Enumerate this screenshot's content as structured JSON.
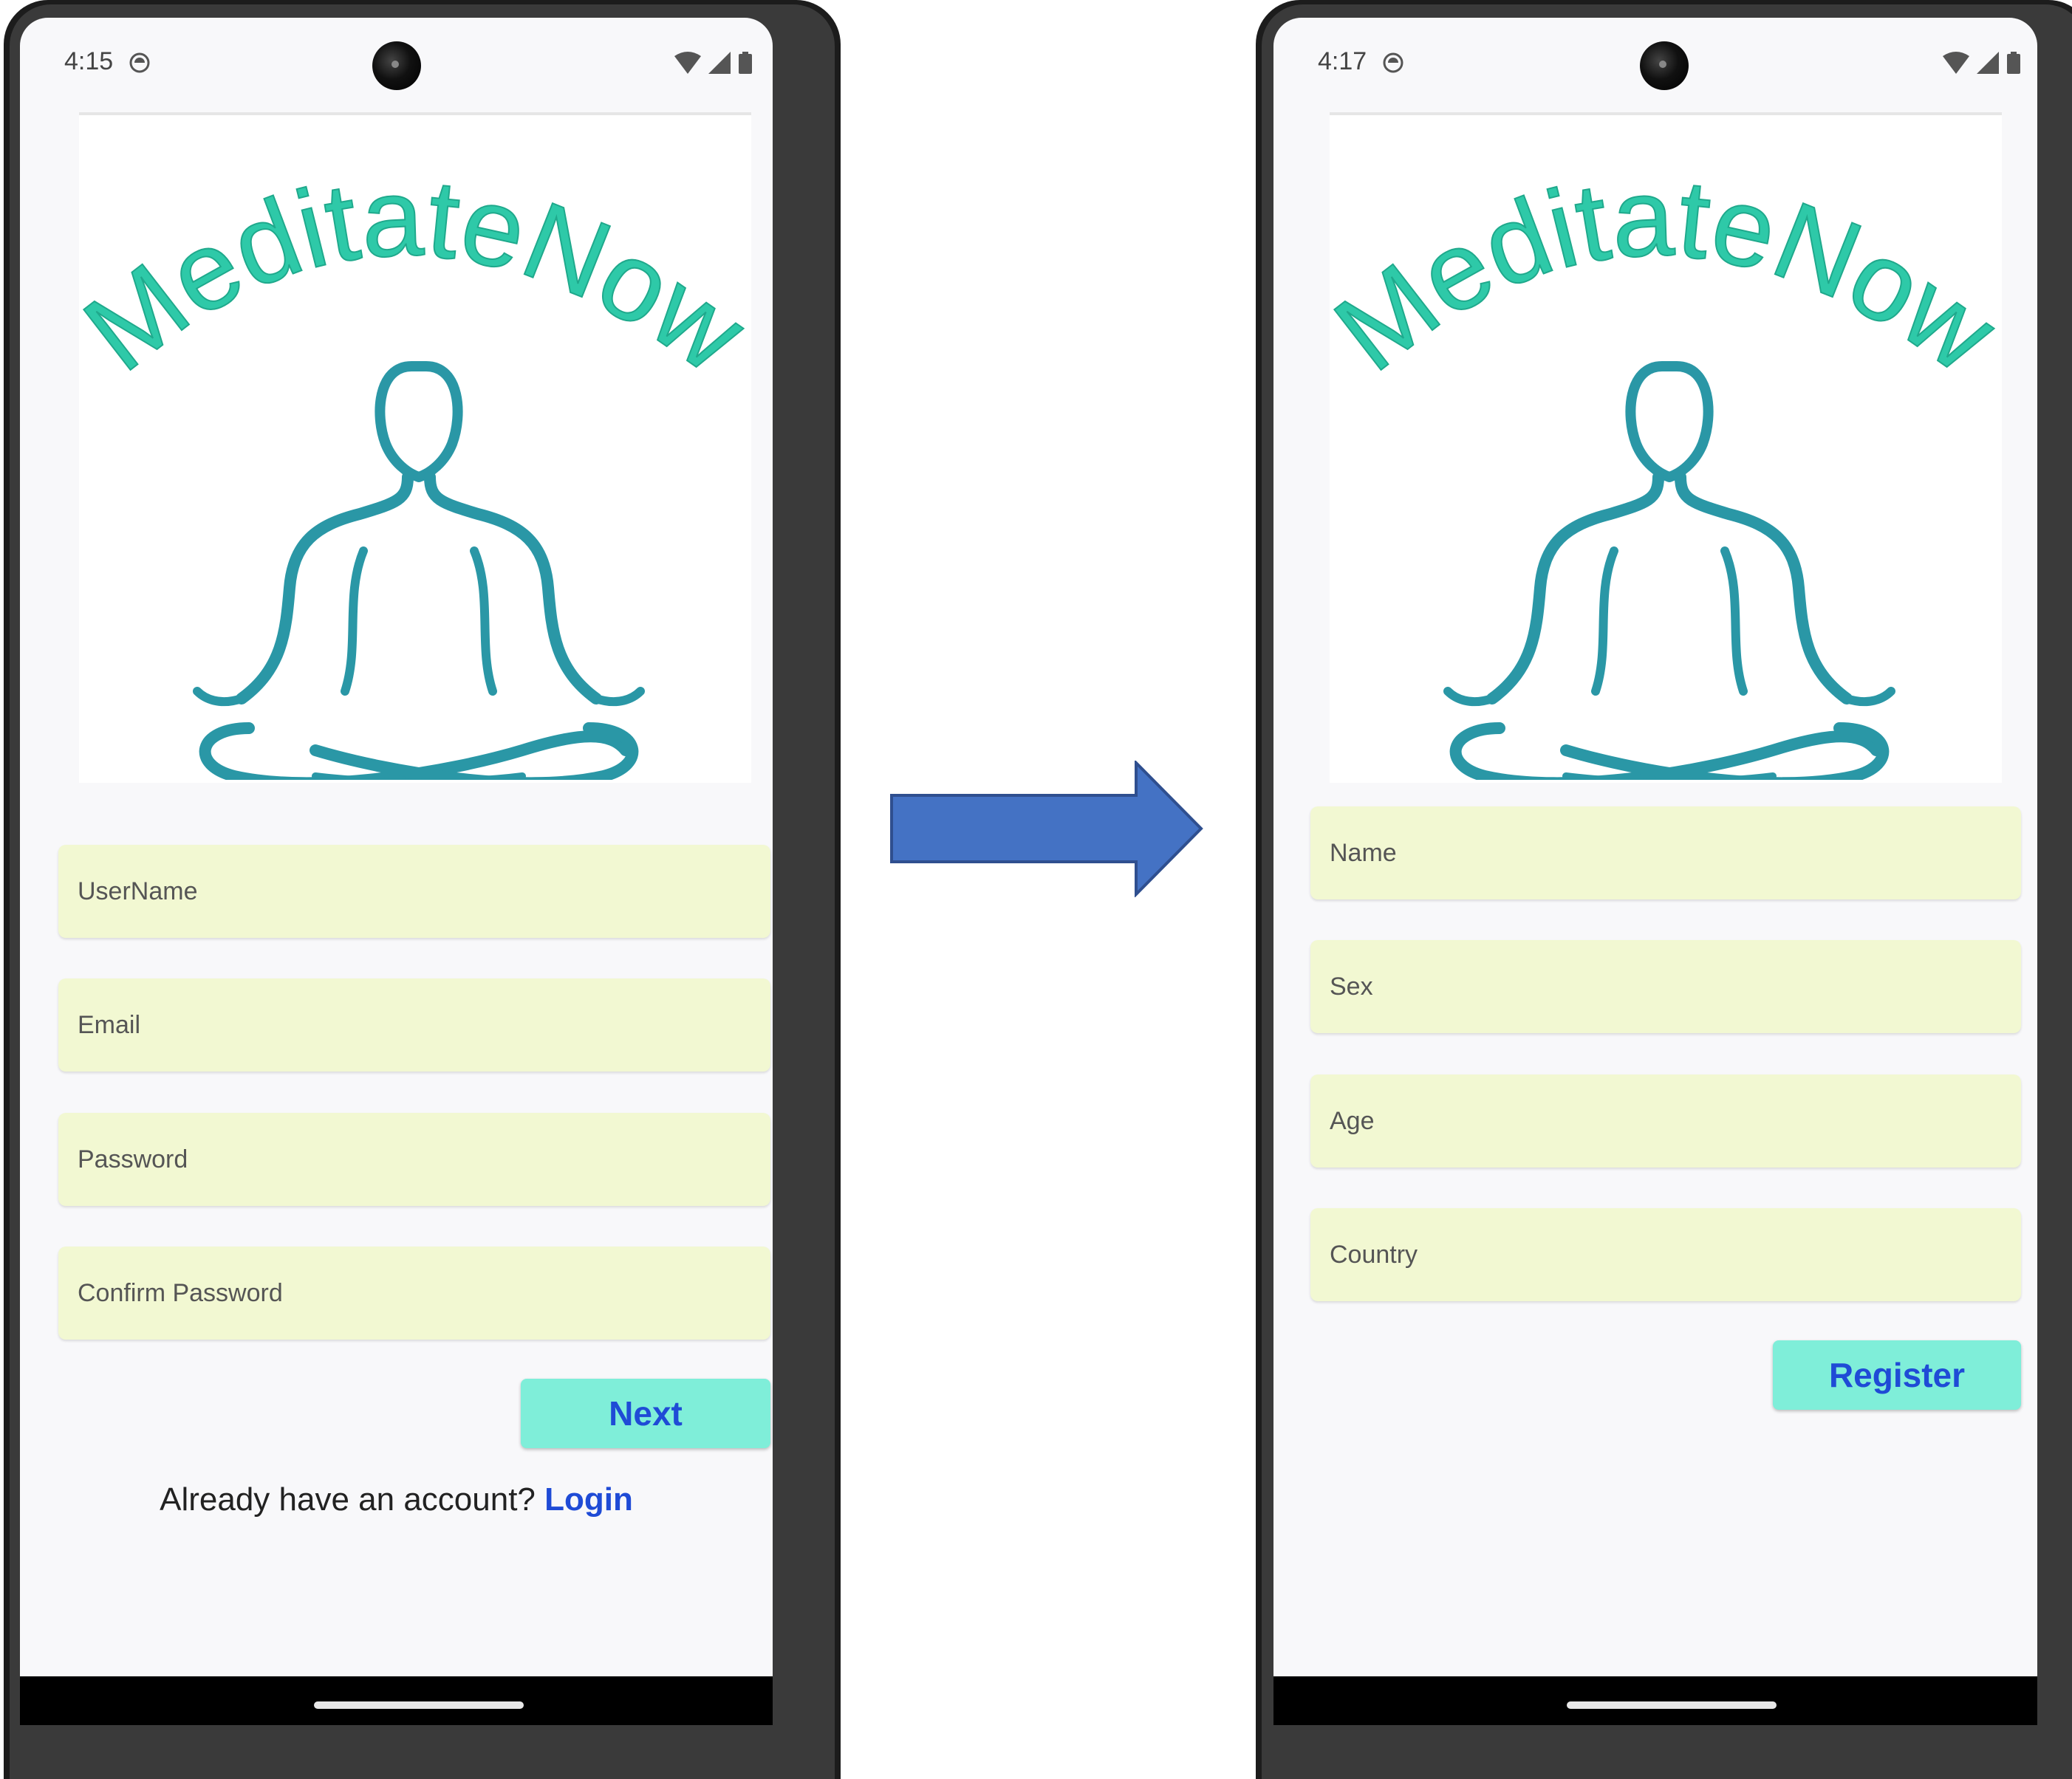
{
  "screens": [
    {
      "status_time": "4:15",
      "logo_text": "MeditateNow",
      "fields": [
        {
          "placeholder": "UserName"
        },
        {
          "placeholder": "Email"
        },
        {
          "placeholder": "Password"
        },
        {
          "placeholder": "Confirm Password"
        }
      ],
      "button_label": "Next",
      "account_prompt": "Already have an account?",
      "login_label": "Login"
    },
    {
      "status_time": "4:17",
      "logo_text": "MeditateNow",
      "fields": [
        {
          "placeholder": "Name"
        },
        {
          "placeholder": "Sex"
        },
        {
          "placeholder": "Age"
        },
        {
          "placeholder": "Country"
        }
      ],
      "button_label": "Register"
    }
  ],
  "colors": {
    "logo_text": "#2ec9a8",
    "logo_figure": "#2a97a6",
    "field_bg": "#f2f8d2",
    "button_bg": "#7feed9",
    "button_text": "#1f4bd6",
    "link": "#1f4bd6",
    "arrow": "#4472c4"
  },
  "icons": [
    "clock-icon",
    "wifi-icon",
    "signal-icon",
    "battery-icon",
    "right-arrow-icon",
    "meditation-figure-icon"
  ]
}
